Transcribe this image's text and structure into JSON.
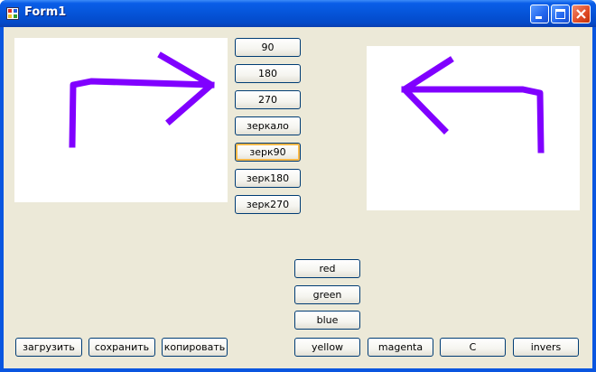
{
  "window": {
    "title": "Form1",
    "accent": "#0a56e0",
    "close_color": "#e04a24"
  },
  "images": {
    "stroke_color": "#8000ff",
    "left": "arrow pointing right",
    "right": "arrow pointing left"
  },
  "rotate_buttons": [
    "90",
    "180",
    "270",
    "зеркало",
    "зерк90",
    "зерк180",
    "зерк270"
  ],
  "focused_button": "зерк90",
  "color_buttons": [
    "red",
    "green",
    "blue"
  ],
  "file_buttons": [
    "загрузить",
    "сохранить",
    "копировать"
  ],
  "bottom_buttons": [
    "yellow",
    "magenta",
    "C",
    "invers"
  ]
}
